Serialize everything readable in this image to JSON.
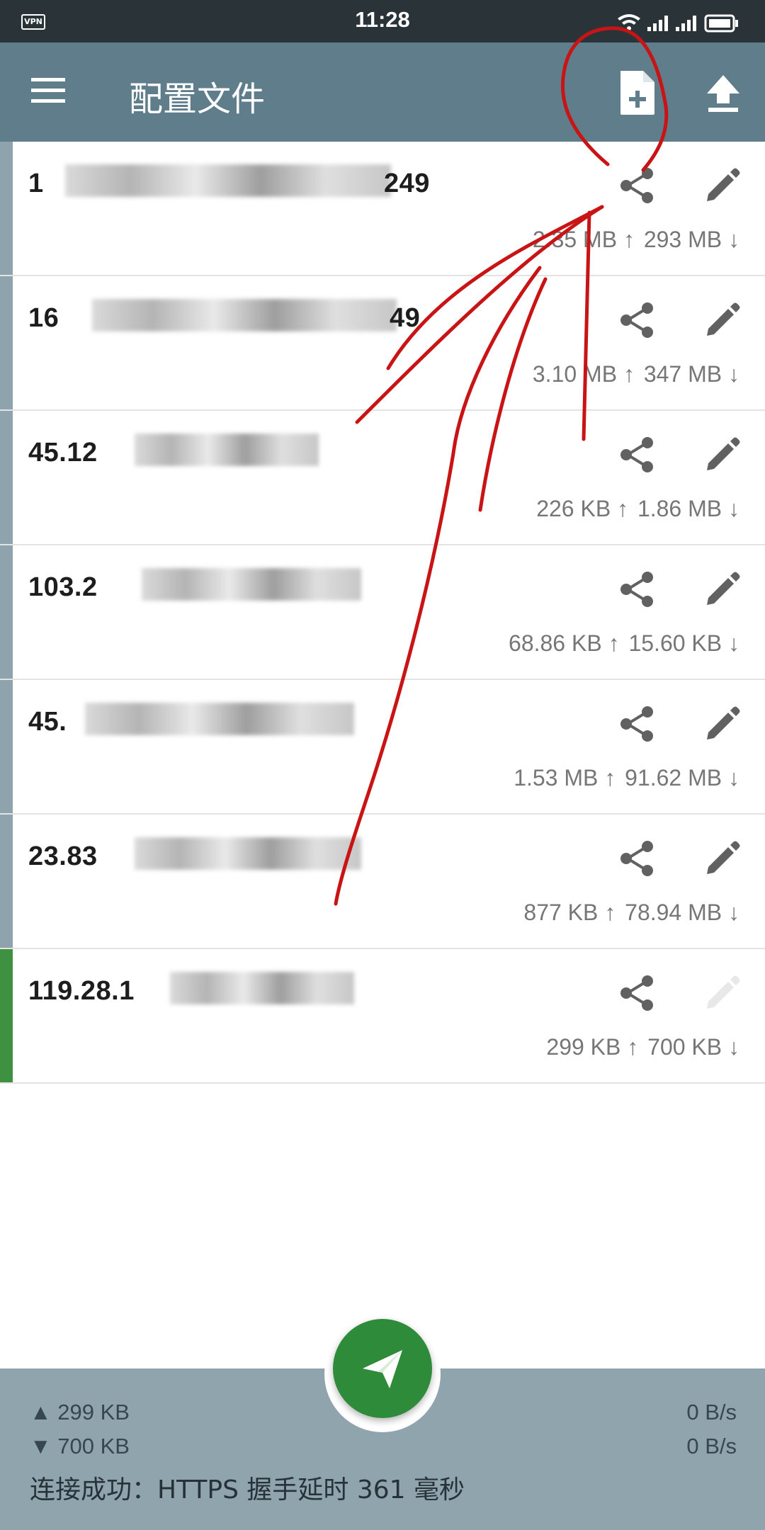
{
  "status_bar": {
    "vpn_label": "VPN",
    "time": "11:28",
    "icons": [
      "wifi-icon",
      "signal-icon",
      "signal-sim2-icon",
      "battery-icon"
    ]
  },
  "toolbar": {
    "title": "配置文件",
    "menu_icon": "menu-icon",
    "add_icon": "add-file-icon",
    "upload_icon": "upload-icon",
    "color": "#607d8b"
  },
  "profiles": [
    {
      "server": "1⁠‧⁠⁠ ⁠‧⁠‧⁠ ⁠‧⁠‧⁠ 249",
      "server_visible": "1",
      "server_tail": "249",
      "up": "2.35 MB",
      "down": "293 MB",
      "active": false
    },
    {
      "server_visible": "16",
      "server_tail": "49",
      "up": "3.10 MB",
      "down": "347 MB",
      "active": false
    },
    {
      "server_visible": "45.12",
      "server_tail": "",
      "up": "226 KB",
      "down": "1.86 MB",
      "active": false
    },
    {
      "server_visible": "103.2",
      "server_tail": "",
      "up": "68.86 KB",
      "down": "15.60 KB",
      "active": false
    },
    {
      "server_visible": "45.",
      "server_tail": "",
      "up": "1.53 MB",
      "down": "91.62 MB",
      "active": false
    },
    {
      "server_visible": "23.83",
      "server_tail": "",
      "up": "877 KB",
      "down": "78.94 MB",
      "active": false
    },
    {
      "server_visible": "119.28.1",
      "server_tail": "",
      "up": "299 KB",
      "down": "700 KB",
      "active": true
    }
  ],
  "arrows": {
    "up": "↑",
    "down": "↓"
  },
  "bottom": {
    "up_total": "▲ 299 KB",
    "down_total": "▼ 700 KB",
    "up_speed": "0 B/s",
    "down_speed": "0 B/s",
    "status": "连接成功：HTTPS 握手延时 361 毫秒"
  },
  "colors": {
    "active_bar": "#3f9142",
    "inactive_bar": "#8fa3ad",
    "fab": "#2e8b3a",
    "bottom_panel": "#90a4ae",
    "annotation": "#c81414"
  }
}
